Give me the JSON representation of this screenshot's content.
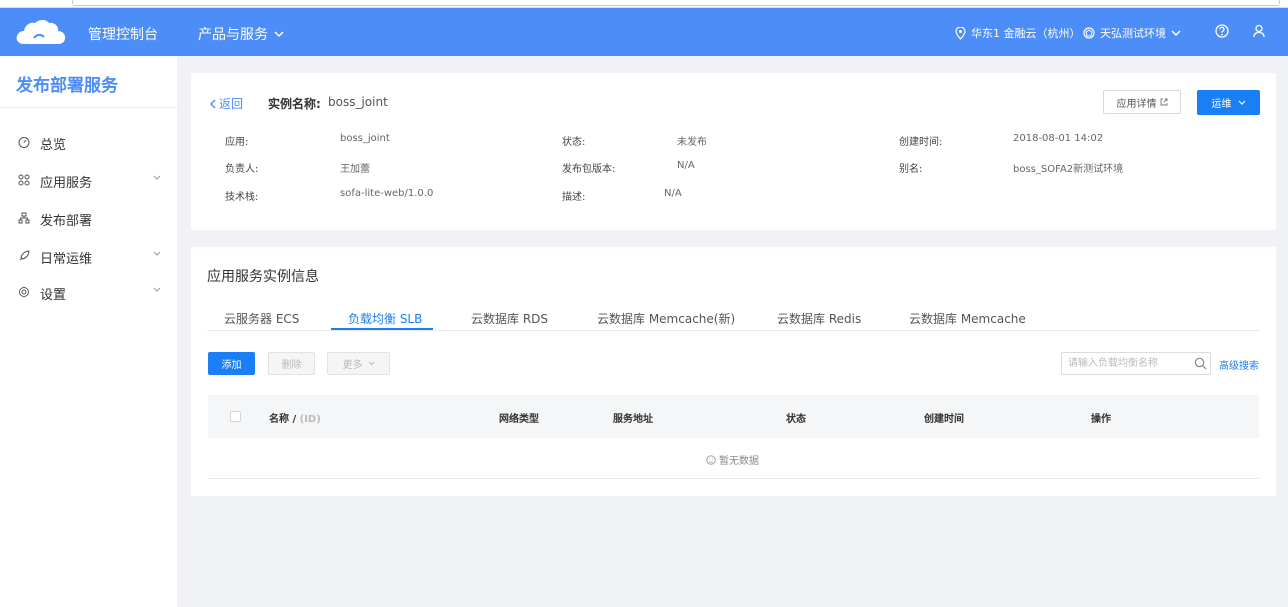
{
  "header": {
    "console_title": "管理控制台",
    "products_label": "产品与服务",
    "region_label": "华东1 金融云（杭州）",
    "env_label": "天弘测试环境"
  },
  "sidebar": {
    "title": "发布部署服务",
    "items": [
      {
        "label": "总览",
        "icon": "dashboard-icon",
        "has_chevron": false
      },
      {
        "label": "应用服务",
        "icon": "apps-icon",
        "has_chevron": true
      },
      {
        "label": "发布部署",
        "icon": "deploy-icon",
        "has_chevron": false
      },
      {
        "label": "日常运维",
        "icon": "rocket-icon",
        "has_chevron": true
      },
      {
        "label": "设置",
        "icon": "gear-icon",
        "has_chevron": true
      }
    ]
  },
  "instance": {
    "back_label": "返回",
    "name_label": "实例名称:",
    "name_value": "boss_joint",
    "detail_button": "应用详情",
    "ops_button": "运维",
    "fields": {
      "app_label": "应用:",
      "app_value": "boss_joint",
      "status_label": "状态:",
      "status_value": "未发布",
      "created_label": "创建时间:",
      "created_value": "2018-08-01 14:02",
      "owner_label": "负责人:",
      "owner_value": "王加蕾",
      "version_label": "发布包版本:",
      "version_value": "N/A",
      "alias_label": "别名:",
      "alias_value": "boss_SOFA2新测试环境",
      "stack_label": "技术栈:",
      "stack_value": "sofa-lite-web/1.0.0",
      "desc_label": "描述:",
      "desc_value": "N/A"
    }
  },
  "service_info": {
    "title": "应用服务实例信息",
    "tabs": [
      "云服务器 ECS",
      "负载均衡 SLB",
      "云数据库 RDS",
      "云数据库 Memcache(新)",
      "云数据库 Redis",
      "云数据库 Memcache"
    ],
    "active_tab": 1,
    "add_button": "添加",
    "delete_button": "删除",
    "more_button": "更多",
    "search_placeholder": "请输入负载均衡名称",
    "advanced_search": "高级搜索",
    "table_headers": {
      "name": "名称 /",
      "name_id": "(ID)",
      "network": "网络类型",
      "address": "服务地址",
      "status": "状态",
      "created": "创建时间",
      "actions": "操作"
    },
    "empty_text": "暂无数据"
  },
  "colors": {
    "brand": "#4d8df7",
    "primary": "#1a7ff5"
  }
}
